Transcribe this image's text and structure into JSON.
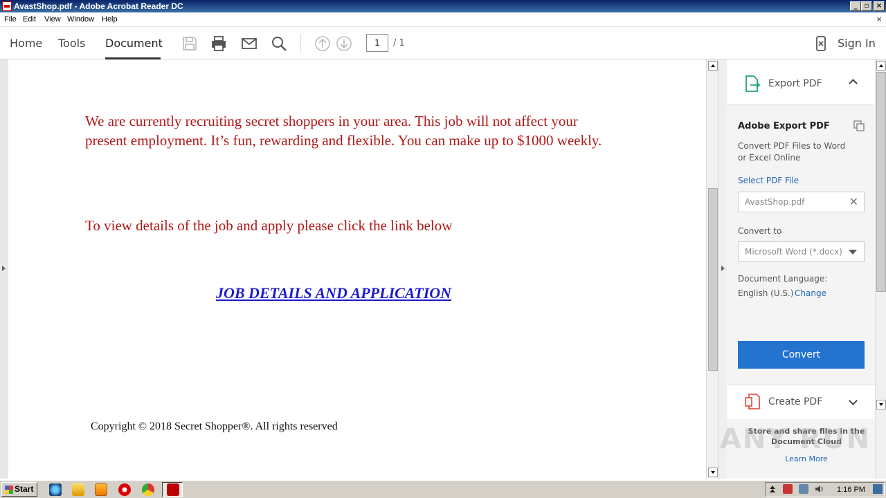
{
  "window": {
    "title": "AvastShop.pdf - Adobe Acrobat Reader DC",
    "min_glyph": "_",
    "max_glyph": "▫",
    "close_glyph": "×"
  },
  "menu": {
    "items": [
      "File",
      "Edit",
      "View",
      "Window",
      "Help"
    ],
    "close_glyph": "×"
  },
  "toolbar": {
    "tabs": [
      "Home",
      "Tools",
      "Document"
    ],
    "active_tab": "Document",
    "page_current": "1",
    "page_total": "/ 1",
    "sign_in": "Sign In"
  },
  "document": {
    "paragraph1": "We are currently recruiting secret shoppers in your area. This job will not affect your present employment. It’s fun, rewarding and flexible.  You can make up to $1000 weekly.",
    "paragraph2": "To view details of the job and apply please click the link below",
    "link_text": "JOB DETAILS AND APPLICATION",
    "copyright": "Copyright © 2018 Secret Shopper®. All rights reserved",
    "text_color": "#b01818",
    "link_color": "#1a1ad0"
  },
  "panel": {
    "export_header": "Export PDF",
    "title": "Adobe Export PDF",
    "description": "Convert PDF Files to Word or Excel Online",
    "select_file_link": "Select PDF File",
    "file_value": "AvastShop.pdf",
    "convert_to_label": "Convert to",
    "convert_to_value": "Microsoft Word (*.docx)",
    "language_label": "Document Language:",
    "language_value": "English (U.S.)",
    "change_link": "Change",
    "convert_button": "Convert",
    "create_header": "Create PDF",
    "cloud_text": "Store and share files in the Document Cloud",
    "learn_more": "Learn More",
    "accent_color": "#2473cf"
  },
  "watermark": "ANY RUN",
  "taskbar": {
    "start_label": "Start",
    "clock": "1:16 PM"
  }
}
